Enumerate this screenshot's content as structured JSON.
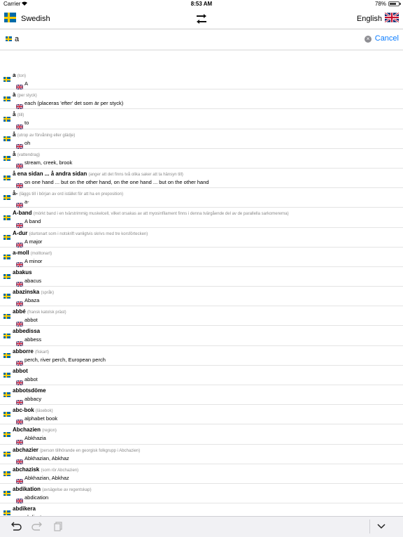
{
  "status_bar": {
    "carrier": "Carrier",
    "time": "8:53 AM",
    "battery": "78%",
    "battery_level": 0.78
  },
  "header": {
    "source_language": "Swedish",
    "target_language": "English",
    "swap_icon": "swap-arrows-icon"
  },
  "search": {
    "query": "a",
    "clear_icon": "clear-icon",
    "cancel_label": "Cancel"
  },
  "entries": [
    {
      "headword": "a",
      "note": "(ton)",
      "translation": "A"
    },
    {
      "headword": "à",
      "note": "(per styck)",
      "translation": "each (placeras 'efter' det som är per styck)"
    },
    {
      "headword": "å",
      "note": "(till)",
      "translation": "to"
    },
    {
      "headword": "å",
      "note": "(utrop av förvåning eller glädje)",
      "translation": "oh"
    },
    {
      "headword": "å",
      "note": "(vattendrag)",
      "translation": "stream, creek, brook"
    },
    {
      "headword": "å ena sidan ... å andra sidan",
      "note": "(anger att det finns två olika saker att ta hänsyn till)",
      "translation": "on one hand ... but on the other hand, on the one hand ... but on the other hand"
    },
    {
      "headword": "å-",
      "note": "(läggs till i början av ord istället för att ha en preposition)",
      "translation": "a-"
    },
    {
      "headword": "A-band",
      "note": "(mörkt band i en tvärstrimmig muskelcell, vilket orsakas av att myosinfilament finns i denna tvärgående del av de parallella sarkomererna)",
      "translation": "A band"
    },
    {
      "headword": "A-dur",
      "note": "(durtonart som i notskrift vanligtvis skrivs med tre korsförtecken)",
      "translation": "A major"
    },
    {
      "headword": "a-moll",
      "note": "(molltonart)",
      "translation": "A minor"
    },
    {
      "headword": "abakus",
      "note": "",
      "translation": "abacus"
    },
    {
      "headword": "abazinska",
      "note": "(språk)",
      "translation": "Abaza"
    },
    {
      "headword": "abbé",
      "note": "(fransk katolsk präst)",
      "translation": "abbot"
    },
    {
      "headword": "abbedissa",
      "note": "",
      "translation": "abbess"
    },
    {
      "headword": "abborre",
      "note": "(fiskart)",
      "translation": "perch, river perch, European perch"
    },
    {
      "headword": "abbot",
      "note": "",
      "translation": "abbot"
    },
    {
      "headword": "abbotsdöme",
      "note": "",
      "translation": "abbacy"
    },
    {
      "headword": "abc-bok",
      "note": "(läsebok)",
      "translation": "alphabet book"
    },
    {
      "headword": "Abchazien",
      "note": "(region)",
      "translation": "Abkhazia"
    },
    {
      "headword": "abchazier",
      "note": "(person tillhörande en georgisk folkgrupp i Abchazien)",
      "translation": "Abkhazian, Abkhaz"
    },
    {
      "headword": "abchazisk",
      "note": "(som rör Abchazien)",
      "translation": "Abkhazian, Abkhaz"
    },
    {
      "headword": "abdikation",
      "note": "(avsägelse av regentskap)",
      "translation": "abdication"
    },
    {
      "headword": "abdikera",
      "note": "",
      "translation": "abdicate"
    }
  ],
  "toolbar": {
    "undo_icon": "undo-icon",
    "redo_icon": "redo-icon",
    "copy_icon": "copy-icon",
    "dismiss_icon": "chevron-down-icon"
  },
  "colors": {
    "accent": "#0a7cff",
    "se_blue": "#006aa7",
    "se_yellow": "#fecc00",
    "uk_blue": "#012169",
    "uk_red": "#c8102e"
  }
}
